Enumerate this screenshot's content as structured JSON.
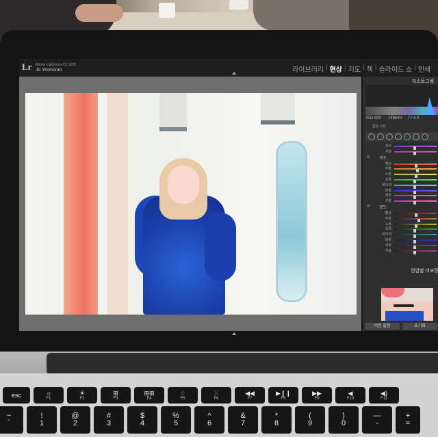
{
  "app": {
    "logo": "Lr",
    "version": "Adobe Lightroom CC 2015",
    "user": "Jo YoonGoo"
  },
  "modules": [
    "라이브러리",
    "현상",
    "지도",
    "책",
    "슬라이드 쇼",
    "인쇄"
  ],
  "active_module": "현상",
  "panel": {
    "histogram_title": "히스토그램",
    "iso": "ISO 800",
    "focal": "148mm",
    "aperture": "f / 4.0",
    "original_photo": "원본 사진",
    "color_section": "색조",
    "luminance_section": "광도",
    "hsl_title": "명암별 색보정",
    "prev_button": "이전 설정",
    "reset_button": "초기화",
    "rows_top": [
      "자주",
      "지홍"
    ],
    "rows_color": [
      "빨강",
      "주황",
      "노랑",
      "초록",
      "바다색",
      "파랑",
      "자주",
      "지홍"
    ],
    "rows_luminance": [
      "빨강",
      "주황",
      "노랑",
      "초록",
      "바다색",
      "파랑",
      "자주",
      "지홍"
    ]
  },
  "keyboard": {
    "fn_row": [
      {
        "main": "esc",
        "sub": ""
      },
      {
        "main": "☼",
        "sub": "F1"
      },
      {
        "main": "☀",
        "sub": "F2"
      },
      {
        "main": "⊞",
        "sub": "F3"
      },
      {
        "main": "⊞⊞",
        "sub": "F4"
      },
      {
        "main": "⁘",
        "sub": "F5"
      },
      {
        "main": "⁙",
        "sub": "F6"
      },
      {
        "main": "◀◀",
        "sub": "F7"
      },
      {
        "main": "▶❙❙",
        "sub": "F8"
      },
      {
        "main": "▶▶",
        "sub": "F9"
      },
      {
        "main": "◀",
        "sub": "F10"
      },
      {
        "main": "◀)",
        "sub": "F11"
      },
      {
        "main": "◀))",
        "sub": "F12"
      }
    ],
    "num_row": [
      {
        "top": "~",
        "bottom": "`"
      },
      {
        "top": "!",
        "bottom": "1"
      },
      {
        "top": "@",
        "bottom": "2"
      },
      {
        "top": "#",
        "bottom": "3"
      },
      {
        "top": "$",
        "bottom": "4"
      },
      {
        "top": "%",
        "bottom": "5"
      },
      {
        "top": "^",
        "bottom": "6"
      },
      {
        "top": "&",
        "bottom": "7"
      },
      {
        "top": "*",
        "bottom": "8"
      },
      {
        "top": "(",
        "bottom": "9"
      },
      {
        "top": ")",
        "bottom": "0"
      },
      {
        "top": "—",
        "bottom": "-"
      },
      {
        "top": "+",
        "bottom": "="
      }
    ]
  },
  "colors": {
    "lightroom_bg": "#2e2e2e",
    "viewer_bg": "#6e6e6e",
    "dress_blue": "#1a3fa8",
    "key_black": "#161616"
  }
}
